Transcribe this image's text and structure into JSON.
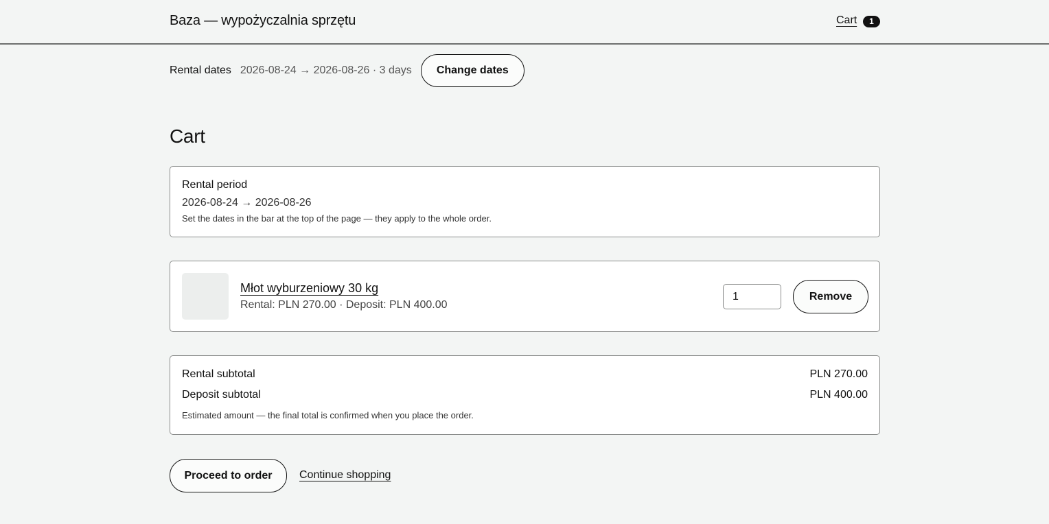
{
  "header": {
    "brand": "Baza — wypożyczalnia sprzętu",
    "cart_label": "Cart",
    "cart_count": "1"
  },
  "dates_bar": {
    "label": "Rental dates",
    "range": "2026-08-24 → 2026-08-26 · 3 days",
    "change_label": "Change dates"
  },
  "page": {
    "title": "Cart"
  },
  "period": {
    "title": "Rental period",
    "range": "2026-08-24 → 2026-08-26",
    "note": "Set the dates in the bar at the top of the page — they apply to the whole order."
  },
  "items": [
    {
      "name": "Młot wyburzeniowy 30 kg",
      "price_line": "Rental: PLN 270.00 · Deposit: PLN 400.00",
      "quantity": "1",
      "remove_label": "Remove"
    }
  ],
  "totals": {
    "rental_label": "Rental subtotal",
    "rental_value": "PLN 270.00",
    "deposit_label": "Deposit subtotal",
    "deposit_value": "PLN 400.00",
    "note": "Estimated amount — the final total is confirmed when you place the order."
  },
  "actions": {
    "proceed_label": "Proceed to order",
    "continue_label": "Continue shopping"
  }
}
